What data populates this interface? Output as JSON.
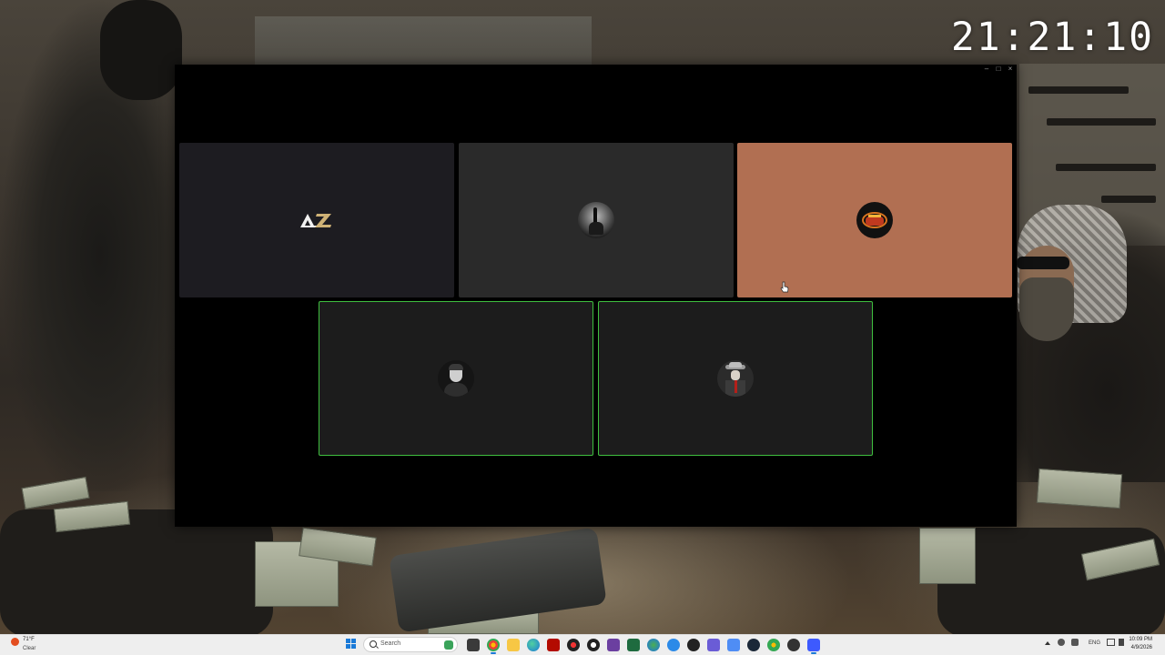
{
  "desktop": {
    "clock": "21:21:10"
  },
  "window": {
    "controls": {
      "minimize": "–",
      "maximize": "□",
      "close": "×"
    },
    "tiles": [
      {
        "id": "tile-1",
        "name": "AZ",
        "bg": "#1d1c21",
        "speaking": false,
        "avatar": "az-logo"
      },
      {
        "id": "tile-2",
        "name": "",
        "bg": "#2a2a2a",
        "speaking": false,
        "avatar": "dark-figure-photo"
      },
      {
        "id": "tile-3",
        "name": "",
        "bg": "#b16f52",
        "speaking": false,
        "avatar": "flame-emblem"
      },
      {
        "id": "tile-4",
        "name": "",
        "bg": "#1c1c1c",
        "speaking": true,
        "avatar": "man-portrait"
      },
      {
        "id": "tile-5",
        "name": "",
        "bg": "#1c1c1c",
        "speaking": true,
        "avatar": "hat-figure"
      }
    ],
    "speaking_border_color": "#3fbf3f"
  },
  "taskbar": {
    "weather": {
      "temp": "71°F",
      "condition": "Clear"
    },
    "search_placeholder": "Search",
    "apps": [
      "file-explorer",
      "edge",
      "chrome",
      "acrobat",
      "media",
      "whatsapp",
      "obs",
      "kick",
      "xbox",
      "vscode",
      "discord-blue",
      "steam",
      "photos",
      "ea",
      "notepad",
      "chrome-2",
      "play",
      "epic",
      "app-active"
    ],
    "tray": {
      "language": "ENG",
      "time": "10:09 PM",
      "date": "4/9/2026"
    }
  }
}
